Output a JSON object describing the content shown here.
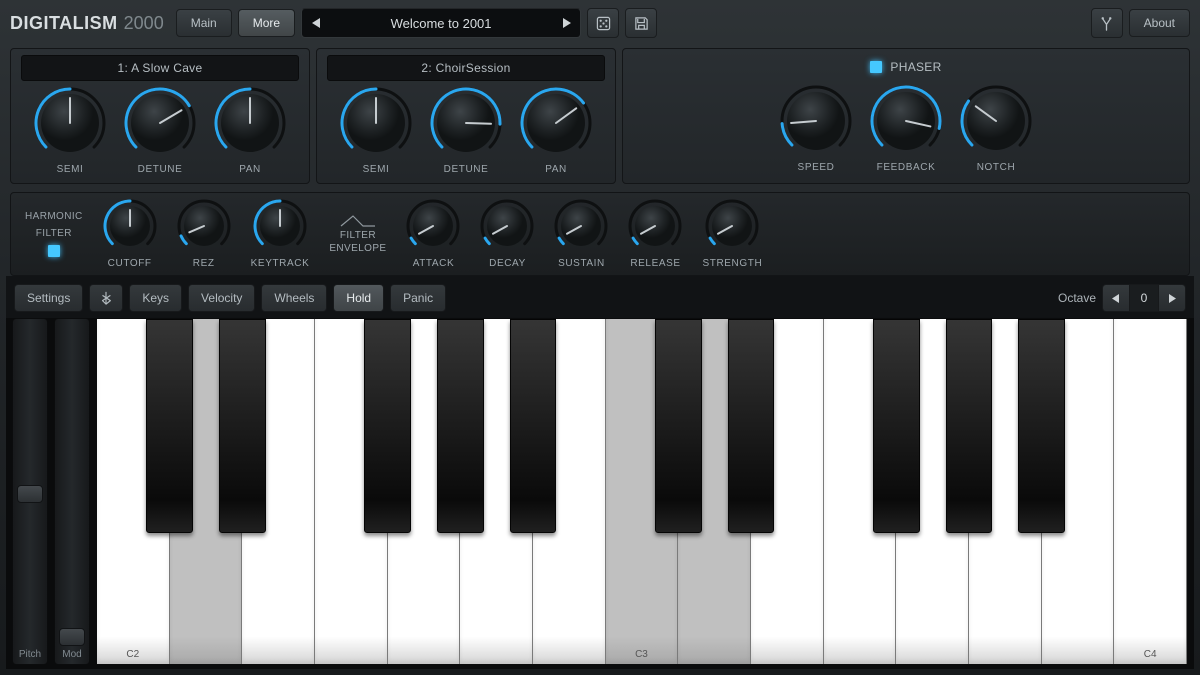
{
  "header": {
    "logo_a": "DIGITALISM",
    "logo_b": "2000",
    "main": "Main",
    "more": "More",
    "about": "About",
    "preset": "Welcome to 2001"
  },
  "osc1": {
    "title": "1: A Slow Cave",
    "k1": "SEMI",
    "k2": "DETUNE",
    "k3": "PAN"
  },
  "osc2": {
    "title": "2: ChoirSession",
    "k1": "SEMI",
    "k2": "DETUNE",
    "k3": "PAN"
  },
  "fx": {
    "title": "PHASER",
    "k1": "SPEED",
    "k2": "FEEDBACK",
    "k3": "NOTCH"
  },
  "filter": {
    "hf_l1": "HARMONIC",
    "hf_l2": "FILTER",
    "k1": "CUTOFF",
    "k2": "REZ",
    "k3": "KEYTRACK",
    "env_l1": "FILTER",
    "env_l2": "ENVELOPE",
    "k4": "ATTACK",
    "k5": "DECAY",
    "k6": "SUSTAIN",
    "k7": "RELEASE",
    "k8": "STRENGTH"
  },
  "keytool": {
    "settings": "Settings",
    "keys": "Keys",
    "velocity": "Velocity",
    "wheels": "Wheels",
    "hold": "Hold",
    "panic": "Panic",
    "octave_label": "Octave",
    "octave_value": "0"
  },
  "wheels": {
    "pitch": "Pitch",
    "mod": "Mod"
  },
  "notes": {
    "c2": "C2",
    "c3": "C3",
    "c4": "C4"
  }
}
